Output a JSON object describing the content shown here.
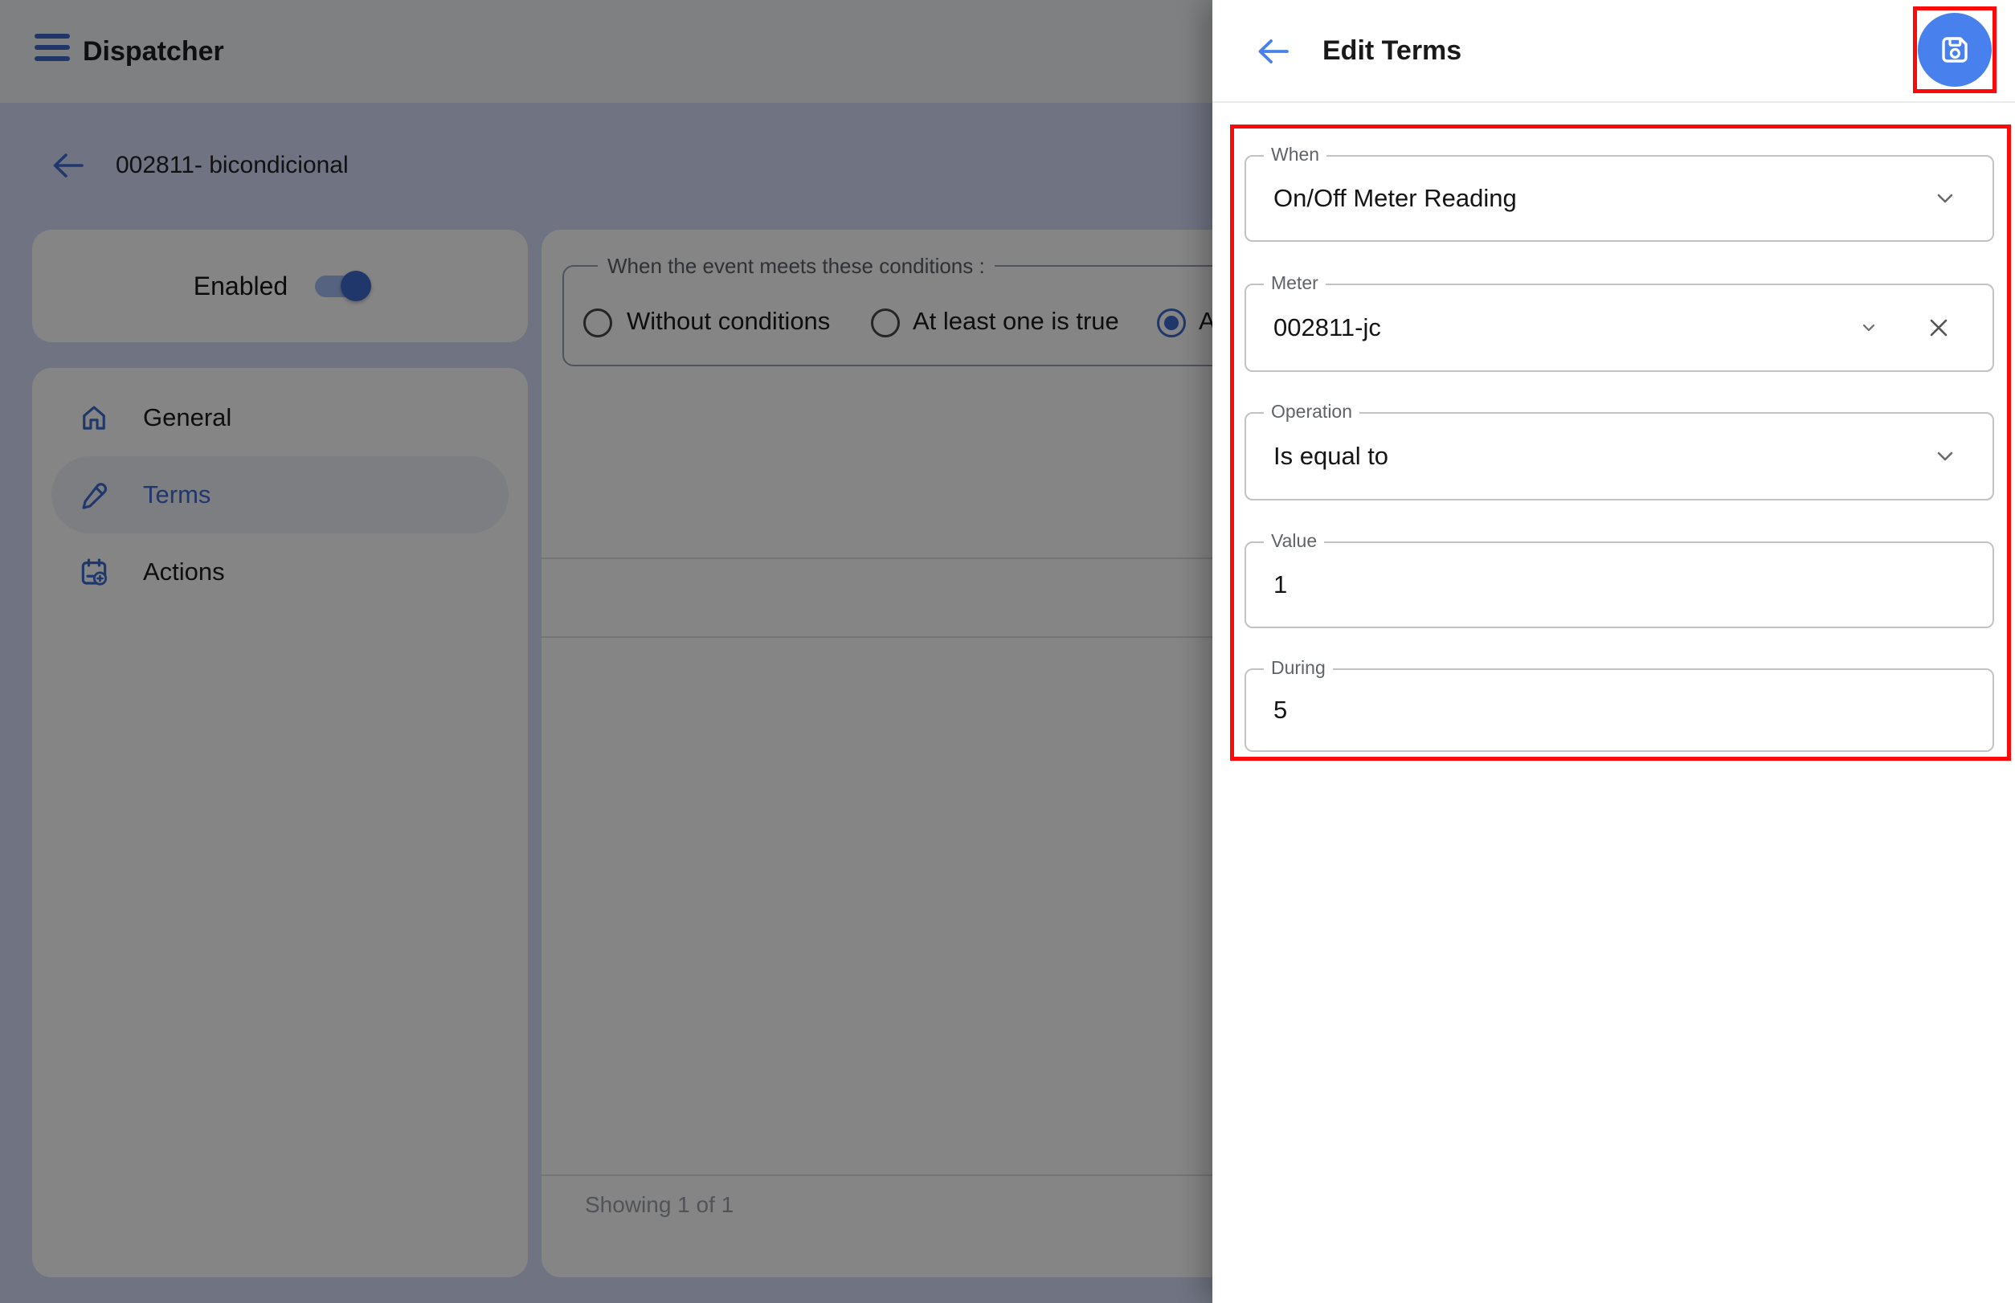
{
  "colors": {
    "accent": "#4880ee",
    "annotation": "#fb0a0a",
    "drawer_bg": "#ffffff",
    "page_bg": "#d7defa"
  },
  "header": {
    "title": "Dispatcher"
  },
  "page": {
    "title": "002811- bicondicional"
  },
  "enabled_card": {
    "label": "Enabled",
    "toggle_state": "on"
  },
  "nav": {
    "items": [
      {
        "label": "General",
        "icon": "home-icon",
        "active": false
      },
      {
        "label": "Terms",
        "icon": "pencil-icon",
        "active": true
      },
      {
        "label": "Actions",
        "icon": "calendar-add-icon",
        "active": false
      }
    ]
  },
  "conditions": {
    "legend": "When the event meets these conditions :",
    "options": [
      {
        "label": "Without conditions",
        "selected": false
      },
      {
        "label": "At least one is true",
        "selected": false
      },
      {
        "label": "A",
        "selected": true
      }
    ]
  },
  "table": {
    "footer": "Showing 1 of 1"
  },
  "drawer": {
    "title": "Edit Terms",
    "back_icon": "arrow-left-icon",
    "save_icon": "save-icon",
    "fields": [
      {
        "label": "When",
        "value": "On/Off Meter Reading",
        "type": "select"
      },
      {
        "label": "Meter",
        "value": "002811-jc",
        "type": "select-clearable"
      },
      {
        "label": "Operation",
        "value": "Is equal to",
        "type": "select"
      },
      {
        "label": "Value",
        "value": "1",
        "type": "text"
      },
      {
        "label": "During",
        "value": "5",
        "type": "text"
      }
    ]
  }
}
